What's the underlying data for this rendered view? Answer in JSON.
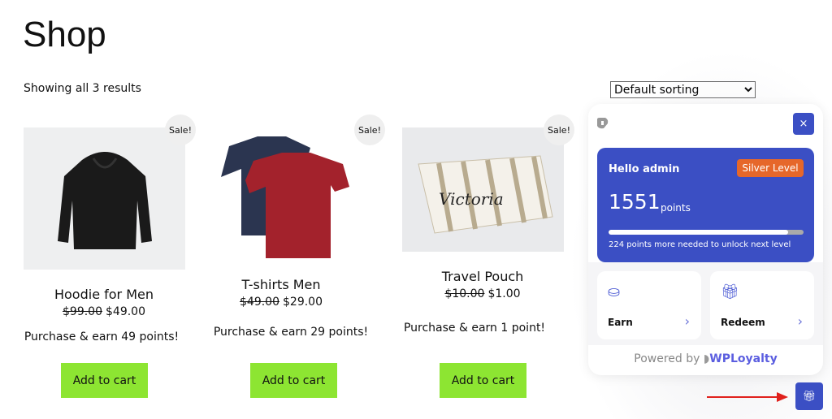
{
  "page": {
    "title": "Shop",
    "result_count": "Showing all 3 results",
    "sorting": "Default sorting"
  },
  "products": [
    {
      "name": "Hoodie for Men",
      "regular_price": "$99.00",
      "sale_price": "$49.00",
      "earn": "Purchase & earn 49 points!",
      "badge": "Sale!",
      "button": "Add to cart"
    },
    {
      "name": "T-shirts Men",
      "regular_price": "$49.00",
      "sale_price": "$29.00",
      "earn": "Purchase & earn 29 points!",
      "badge": "Sale!",
      "button": "Add to cart"
    },
    {
      "name": "Travel Pouch",
      "regular_price": "$10.00",
      "sale_price": "$1.00",
      "earn": "Purchase & earn 1 point!",
      "badge": "Sale!",
      "button": "Add to cart"
    }
  ],
  "widget": {
    "close": "×",
    "greeting": "Hello admin",
    "level": "Silver Level",
    "points": "1551",
    "points_label": "points",
    "progress_percent": 92,
    "progress_text": "224 points more needed to unlock next level",
    "earn": "Earn",
    "redeem": "Redeem",
    "powered_by": "Powered by",
    "brand": "WPLoyalty",
    "accent": "#3b4fc4",
    "level_color": "#e6672a"
  }
}
